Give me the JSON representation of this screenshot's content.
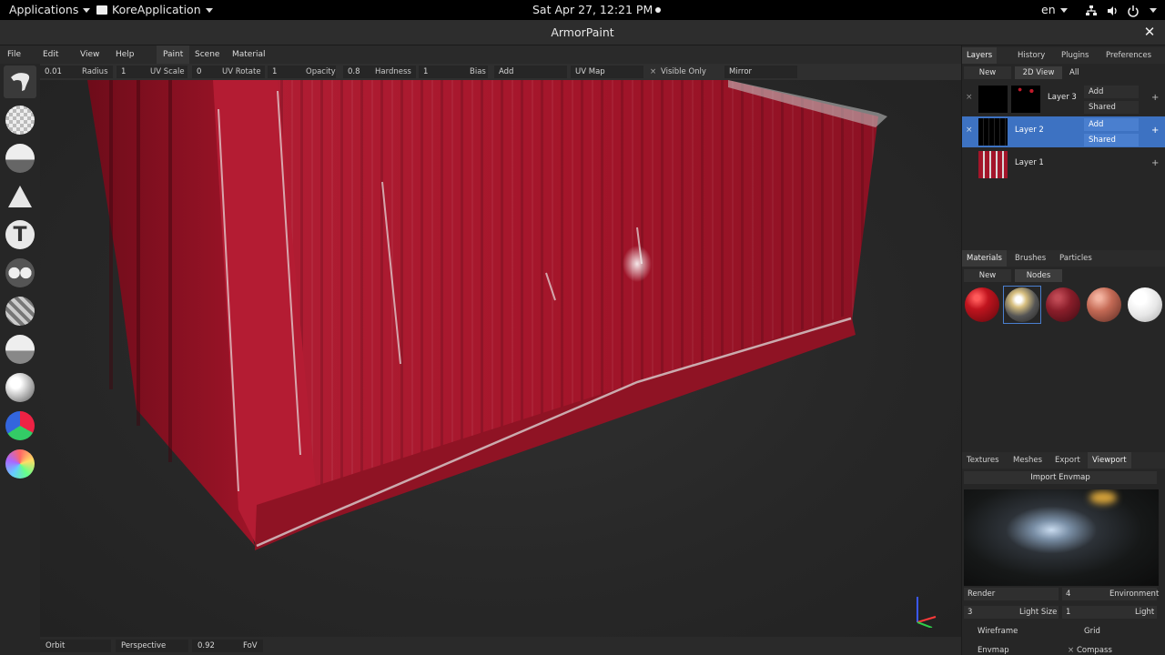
{
  "system_bar": {
    "applications": "Applications",
    "app_name": "KoreApplication",
    "clock": "Sat Apr 27, 12:21 PM",
    "language": "en"
  },
  "window": {
    "title": "ArmorPaint"
  },
  "menu": {
    "file": "File",
    "edit": "Edit",
    "view": "View",
    "help": "Help",
    "tab_paint": "Paint",
    "tab_scene": "Scene",
    "tab_material": "Material"
  },
  "tool_options": {
    "radius_value": "0.01",
    "radius_label": "Radius",
    "uvscale_value": "1",
    "uvscale_label": "UV Scale",
    "uvrotate_value": "0",
    "uvrotate_label": "UV Rotate",
    "opacity_value": "1",
    "opacity_label": "Opacity",
    "hardness_value": "0.8",
    "hardness_label": "Hardness",
    "bias_value": "1",
    "bias_label": "Bias",
    "blend_mode": "Add",
    "uv_map": "UV Map",
    "visible_only_check": "×",
    "visible_only": "Visible Only",
    "mirror": "Mirror"
  },
  "tools": {
    "text_glyph": "T"
  },
  "status": {
    "camera_mode": "Orbit",
    "projection": "Perspective",
    "fov_value": "0.92",
    "fov_label": "FoV"
  },
  "layers_panel": {
    "tabs": [
      "Layers",
      "History",
      "Plugins",
      "Preferences"
    ],
    "btn_new": "New",
    "btn_2dview": "2D View",
    "filter": "All",
    "layers": [
      {
        "name": "Layer 3",
        "blend": "Add",
        "mode": "Shared",
        "close": "×",
        "plus": "+"
      },
      {
        "name": "Layer 2",
        "blend": "Add",
        "mode": "Shared",
        "close": "×",
        "plus": "+"
      },
      {
        "name": "Layer 1",
        "plus": "+"
      }
    ]
  },
  "materials_panel": {
    "tabs": [
      "Materials",
      "Brushes",
      "Particles"
    ],
    "btn_new": "New",
    "btn_nodes": "Nodes"
  },
  "viewport_panel": {
    "tabs": [
      "Textures",
      "Meshes",
      "Export",
      "Viewport"
    ],
    "import_envmap": "Import Envmap",
    "render_label": "Render",
    "env_value": "4",
    "env_label": "Environment",
    "lightsize_value": "3",
    "lightsize_label": "Light Size",
    "light_value": "1",
    "light_label": "Light",
    "wireframe": "Wireframe",
    "grid": "Grid",
    "envmap": "Envmap",
    "compass_check": "×",
    "compass": "Compass"
  },
  "colors": {
    "container_red": "#a3152a",
    "selection_blue": "#3d72c2",
    "panel_bg": "#262626"
  }
}
